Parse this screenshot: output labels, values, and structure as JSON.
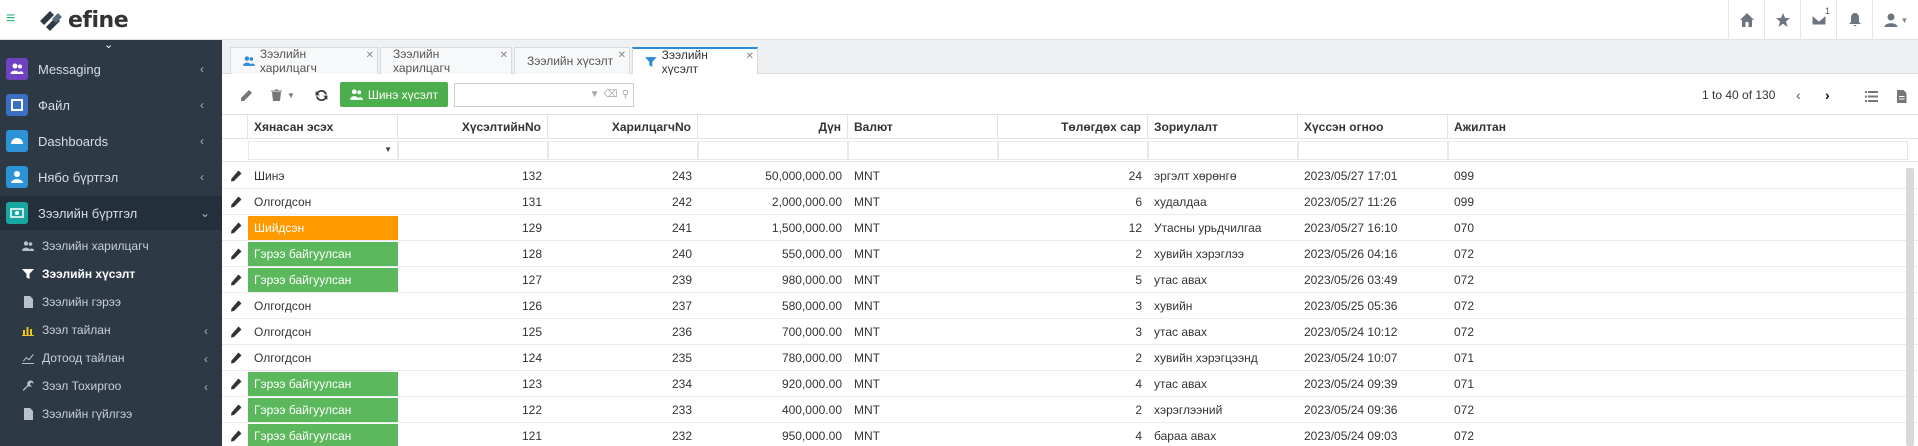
{
  "app": {
    "logo_text": "efine"
  },
  "topbar": {
    "mail_badge": "1"
  },
  "sidebar": {
    "items": [
      {
        "label": "Messaging",
        "color": "#6f42c1",
        "icon": "users-icon"
      },
      {
        "label": "Файл",
        "color": "#3b6fc4",
        "icon": "file-icon"
      },
      {
        "label": "Dashboards",
        "color": "#2c93d6",
        "icon": "dashboard-icon"
      },
      {
        "label": "Нябо бүртгэл",
        "color": "#2c93d6",
        "icon": "user-icon"
      },
      {
        "label": "Зээлийн бүртгэл",
        "color": "#1aa6a0",
        "icon": "money-icon"
      }
    ],
    "subitems": [
      {
        "label": "Зээлийн харилцагч"
      },
      {
        "label": "Зээлийн хүсэлт"
      },
      {
        "label": "Зээлийн гэрээ"
      },
      {
        "label": "Зээл тайлан"
      },
      {
        "label": "Дотоод тайлан"
      },
      {
        "label": "Зээл Тохиргоо"
      },
      {
        "label": "Зээлийн гүйлгээ"
      }
    ]
  },
  "tabs": [
    {
      "label": "Зээлийн харилцагч"
    },
    {
      "label": "Зээлийн харилцагч"
    },
    {
      "label": "Зээлийн хүсэлт"
    },
    {
      "label": "Зээлийн хүсэлт"
    }
  ],
  "toolbar": {
    "new_label": "Шинэ хүсэлт",
    "pager_text": "1 to 40 of 130"
  },
  "table": {
    "headers": [
      "Хянасан эсэх",
      "ХүсэлтийнNo",
      "ХарилцагчNo",
      "Дүн",
      "Валют",
      "Төлөгдөх сар",
      "Зориулалт",
      "Хүссэн огноо",
      "Ажилтан"
    ],
    "rows": [
      {
        "status": "Шинэ",
        "status_style": "none",
        "req": "132",
        "cust": "243",
        "amount": "50,000,000.00",
        "cur": "MNT",
        "months": "24",
        "purpose": "эргэлт хөрөнгө",
        "date": "2023/05/27 17:01",
        "emp": "099"
      },
      {
        "status": "Олгогдсон",
        "status_style": "none",
        "req": "131",
        "cust": "242",
        "amount": "2,000,000.00",
        "cur": "MNT",
        "months": "6",
        "purpose": "худалдаа",
        "date": "2023/05/27 11:26",
        "emp": "099"
      },
      {
        "status": "Шийдсэн",
        "status_style": "orange",
        "req": "129",
        "cust": "241",
        "amount": "1,500,000.00",
        "cur": "MNT",
        "months": "12",
        "purpose": "Утасны урьдчилгаа",
        "date": "2023/05/27 16:10",
        "emp": "070"
      },
      {
        "status": "Гэрээ байгуулсан",
        "status_style": "green",
        "req": "128",
        "cust": "240",
        "amount": "550,000.00",
        "cur": "MNT",
        "months": "2",
        "purpose": "хувийн хэрэглээ",
        "date": "2023/05/26 04:16",
        "emp": "072"
      },
      {
        "status": "Гэрээ байгуулсан",
        "status_style": "green",
        "req": "127",
        "cust": "239",
        "amount": "980,000.00",
        "cur": "MNT",
        "months": "5",
        "purpose": "утас авах",
        "date": "2023/05/26 03:49",
        "emp": "072"
      },
      {
        "status": "Олгогдсон",
        "status_style": "none",
        "req": "126",
        "cust": "237",
        "amount": "580,000.00",
        "cur": "MNT",
        "months": "3",
        "purpose": "хувийн",
        "date": "2023/05/25 05:36",
        "emp": "072"
      },
      {
        "status": "Олгогдсон",
        "status_style": "none",
        "req": "125",
        "cust": "236",
        "amount": "700,000.00",
        "cur": "MNT",
        "months": "3",
        "purpose": "утас авах",
        "date": "2023/05/24 10:12",
        "emp": "072"
      },
      {
        "status": "Олгогдсон",
        "status_style": "none",
        "req": "124",
        "cust": "235",
        "amount": "780,000.00",
        "cur": "MNT",
        "months": "2",
        "purpose": "хувийн хэрэгцээнд",
        "date": "2023/05/24 10:07",
        "emp": "071"
      },
      {
        "status": "Гэрээ байгуулсан",
        "status_style": "green",
        "req": "123",
        "cust": "234",
        "amount": "920,000.00",
        "cur": "MNT",
        "months": "4",
        "purpose": "утас авах",
        "date": "2023/05/24 09:39",
        "emp": "071"
      },
      {
        "status": "Гэрээ байгуулсан",
        "status_style": "green",
        "req": "122",
        "cust": "233",
        "amount": "400,000.00",
        "cur": "MNT",
        "months": "2",
        "purpose": "хэрэглээний",
        "date": "2023/05/24 09:36",
        "emp": "072"
      },
      {
        "status": "Гэрээ байгуулсан",
        "status_style": "green",
        "req": "121",
        "cust": "232",
        "amount": "950,000.00",
        "cur": "MNT",
        "months": "4",
        "purpose": "бараа авах",
        "date": "2023/05/24 09:03",
        "emp": "072"
      }
    ]
  }
}
